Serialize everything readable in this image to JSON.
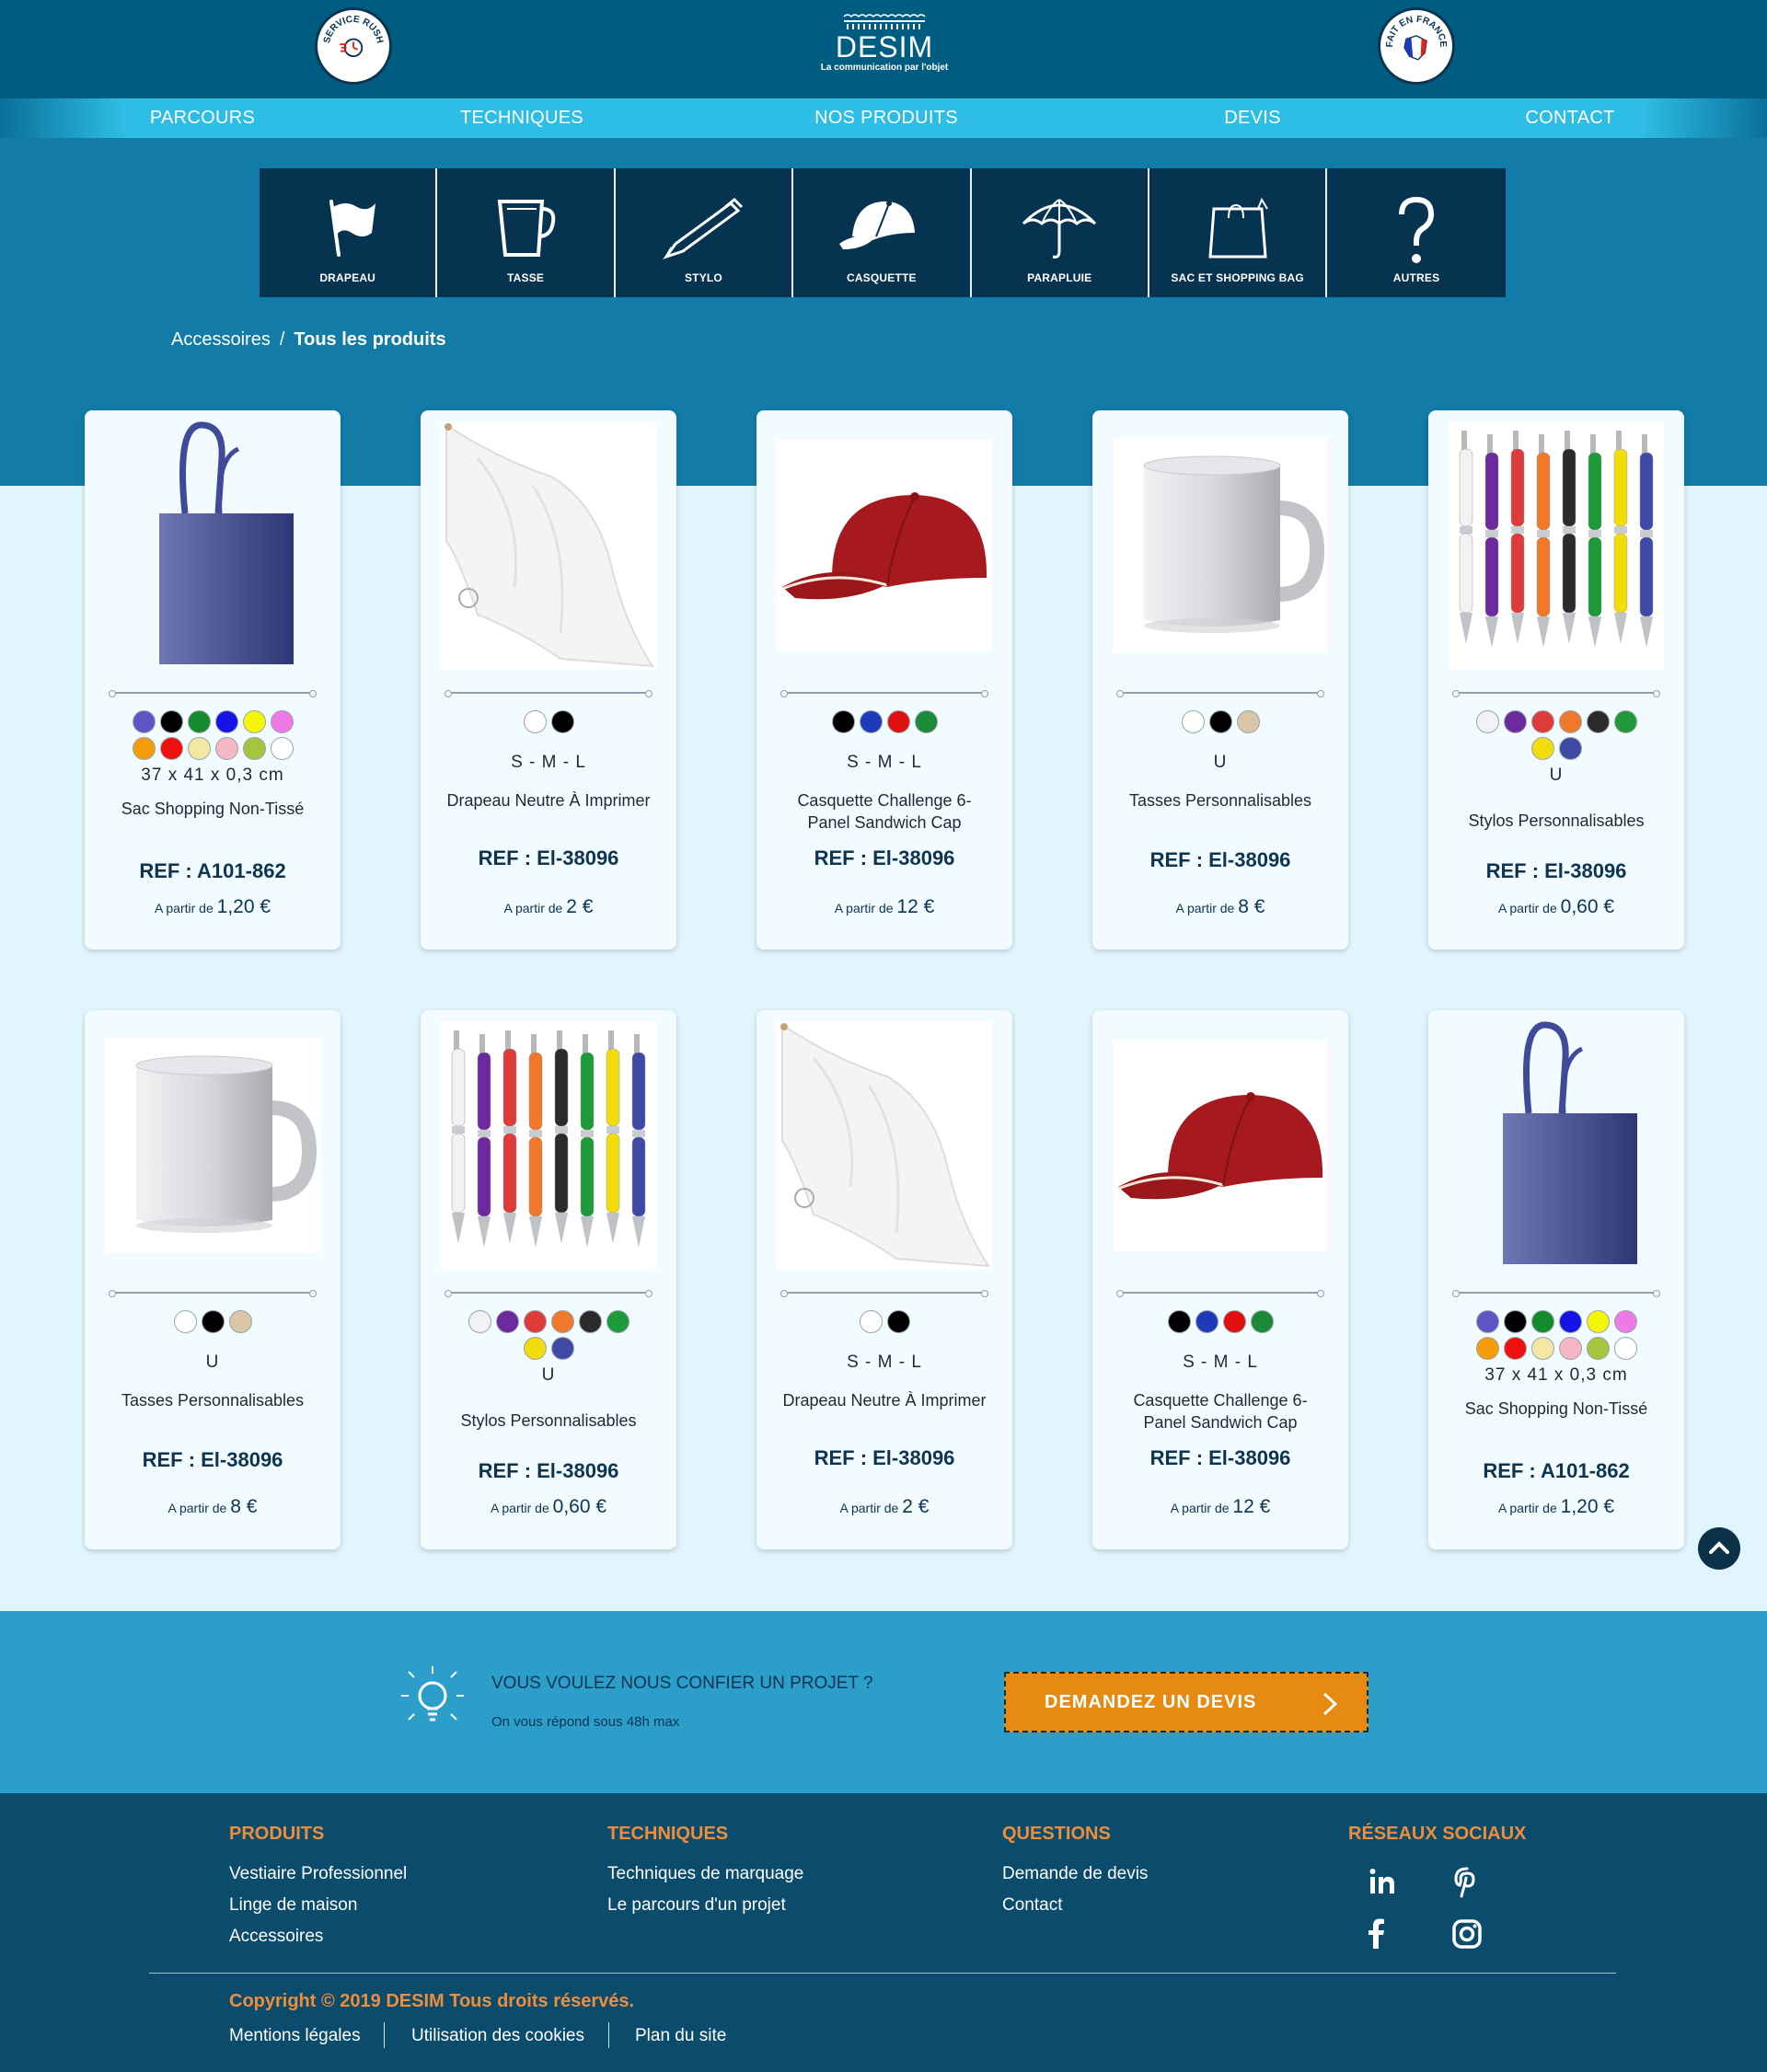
{
  "header": {
    "badge_left": "SERVICE RUSH",
    "badge_right": "FAIT EN FRANCE",
    "logo_name": "DESIM",
    "logo_tagline": "La communication par l'objet"
  },
  "nav": [
    "PARCOURS",
    "TECHNIQUES",
    "NOS PRODUITS",
    "DEVIS",
    "CONTACT"
  ],
  "categories": [
    {
      "label": "DRAPEAU",
      "icon": "flag-icon"
    },
    {
      "label": "TASSE",
      "icon": "mug-icon"
    },
    {
      "label": "STYLO",
      "icon": "pen-icon"
    },
    {
      "label": "CASQUETTE",
      "icon": "cap-icon"
    },
    {
      "label": "PARAPLUIE",
      "icon": "umbrella-icon"
    },
    {
      "label": "SAC ET SHOPPING BAG",
      "icon": "shopping-bag-icon"
    },
    {
      "label": "AUTRES",
      "icon": "question-mark-icon"
    }
  ],
  "breadcrumb": {
    "parent": "Accessoires",
    "separator": "/",
    "current": "Tous les produits"
  },
  "price_prefix": "A partir de",
  "products": [
    {
      "type": "bag",
      "colors": [
        "#5b56c4",
        "#000000",
        "#138a2b",
        "#1414e6",
        "#f5f50a",
        "#ee7ae8",
        "#f59c0a",
        "#f01010",
        "#f2e8a4",
        "#f5b7c4",
        "#a7c43f",
        "#ffffff"
      ],
      "size": "37 x 41 x 0,3 cm",
      "name": "Sac Shopping Non-Tissé",
      "ref": "REF : A101-862",
      "price": "1,20 €"
    },
    {
      "type": "flag",
      "colors": [
        "#ffffff",
        "#000000"
      ],
      "size": "S - M - L",
      "name": "Drapeau Neutre À Imprimer",
      "ref": "REF : El-38096",
      "price": "2 €"
    },
    {
      "type": "cap",
      "colors": [
        "#000000",
        "#1d3ab8",
        "#e00f10",
        "#1a8a3a"
      ],
      "size": "S - M - L",
      "name": "Casquette Challenge 6-Panel Sandwich Cap",
      "ref": "REF : El-38096",
      "price": "12 €"
    },
    {
      "type": "mug",
      "colors": [
        "#ffffff",
        "#000000",
        "#d8c6a6"
      ],
      "size": "U",
      "name": "Tasses Personnalisables",
      "ref": "REF : El-38096",
      "price": "8 €"
    },
    {
      "type": "pens",
      "colors": [
        "#f2f2f5",
        "#6c2a9e",
        "#de3b3b",
        "#f0782a",
        "#2b2b2b",
        "#1e9a3a",
        "#f2dc0c",
        "#3e4aa6"
      ],
      "size": "U",
      "name": "Stylos Personnalisables",
      "ref": "REF : El-38096",
      "price": "0,60 €"
    },
    {
      "type": "mug",
      "colors": [
        "#ffffff",
        "#000000",
        "#d8c6a6"
      ],
      "size": "U",
      "name": "Tasses Personnalisables",
      "ref": "REF : El-38096",
      "price": "8 €"
    },
    {
      "type": "pens",
      "colors": [
        "#f2f2f5",
        "#6c2a9e",
        "#de3b3b",
        "#f0782a",
        "#2b2b2b",
        "#1e9a3a",
        "#f2dc0c",
        "#3e4aa6"
      ],
      "size": "U",
      "name": "Stylos Personnalisables",
      "ref": "REF : El-38096",
      "price": "0,60 €"
    },
    {
      "type": "flag",
      "colors": [
        "#ffffff",
        "#000000"
      ],
      "size": "S - M - L",
      "name": "Drapeau Neutre À Imprimer",
      "ref": "REF : El-38096",
      "price": "2 €"
    },
    {
      "type": "cap",
      "colors": [
        "#000000",
        "#1d3ab8",
        "#e00f10",
        "#1a8a3a"
      ],
      "size": "S - M - L",
      "name": "Casquette Challenge 6-Panel Sandwich Cap",
      "ref": "REF : El-38096",
      "price": "12 €"
    },
    {
      "type": "bag",
      "colors": [
        "#5b56c4",
        "#000000",
        "#138a2b",
        "#1414e6",
        "#f5f50a",
        "#ee7ae8",
        "#f59c0a",
        "#f01010",
        "#f2e8a4",
        "#f5b7c4",
        "#a7c43f",
        "#ffffff"
      ],
      "size": "37 x 41 x 0,3 cm",
      "name": "Sac Shopping Non-Tissé",
      "ref": "REF : A101-862",
      "price": "1,20 €"
    }
  ],
  "cta": {
    "title": "VOUS VOULEZ NOUS CONFIER UN PROJET ?",
    "subtitle": "On vous répond sous 48h max",
    "button": "DEMANDEZ UN DEVIS"
  },
  "footer": {
    "produits": {
      "title": "PRODUITS",
      "links": [
        "Vestiaire Professionnel",
        "Linge de maison",
        "Accessoires"
      ]
    },
    "techniques": {
      "title": "TECHNIQUES",
      "links": [
        "Techniques de marquage",
        "Le parcours d'un projet"
      ]
    },
    "questions": {
      "title": "QUESTIONS",
      "links": [
        "Demande de devis",
        "Contact"
      ]
    },
    "social": {
      "title": "RÉSEAUX SOCIAUX",
      "icons": [
        "linkedin-icon",
        "pinterest-icon",
        "facebook-icon",
        "instagram-icon"
      ]
    },
    "copyright": "Copyright © 2019 DESIM Tous droits réservés.",
    "legal": [
      "Mentions légales",
      "Utilisation des cookies",
      "Plan du site"
    ]
  },
  "colors": {
    "header": "#005d81",
    "nav": "#2ebde4",
    "hero": "#127ba7",
    "category_bar": "#06334f",
    "cta": "#2b9fca",
    "cta_button": "#e68a11",
    "footer": "#0b4b6c",
    "footer_heading": "#ef8d3b"
  }
}
